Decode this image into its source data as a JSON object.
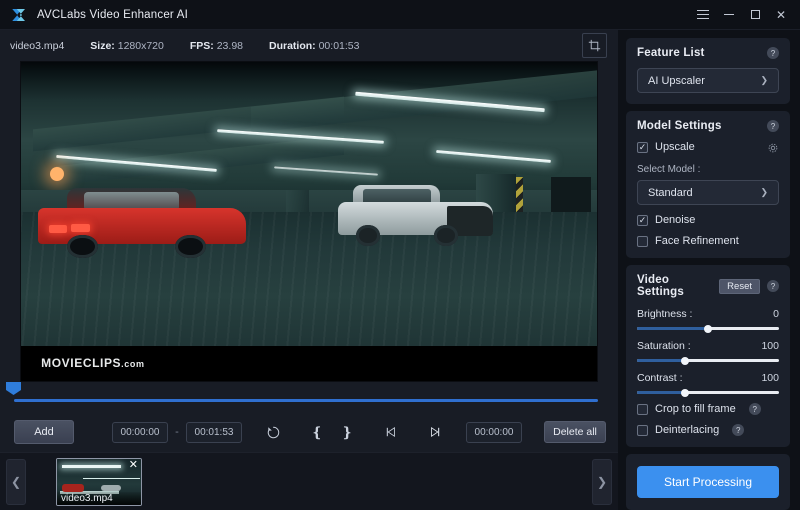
{
  "titlebar": {
    "app_title": "AVCLabs Video Enhancer AI",
    "logo_icon": "play-logo-icon",
    "menu_icon": "hamburger-menu-icon",
    "minimize_icon": "minimize-icon",
    "maximize_icon": "maximize-icon",
    "close_icon": "close-icon"
  },
  "infobar": {
    "filename": "video3.mp4",
    "size_key": "Size:",
    "size_value": "1280x720",
    "fps_key": "FPS:",
    "fps_value": "23.98",
    "duration_key": "Duration:",
    "duration_value": "00:01:53",
    "crop_icon": "crop-icon"
  },
  "preview": {
    "watermark": "MOVIECLIPS",
    "watermark_suffix": ".com"
  },
  "controls": {
    "add_label": "Add",
    "start_time": "00:00:00",
    "separator": "-",
    "end_time": "00:01:53",
    "revert_icon": "revert-icon",
    "mark_in_icon": "mark-in-icon",
    "mark_out_icon": "mark-out-icon",
    "prev_frame_icon": "prev-frame-icon",
    "next_frame_icon": "next-frame-icon",
    "current_time": "00:00:00",
    "delete_all_label": "Delete all"
  },
  "filmstrip": {
    "prev_icon": "chevron-left-icon",
    "next_icon": "chevron-right-icon",
    "remove_icon": "close-icon",
    "items": [
      {
        "label": "video3.mp4"
      }
    ]
  },
  "feature_list": {
    "title": "Feature List",
    "help_icon": "help-icon",
    "selected": "AI Upscaler",
    "chevron_icon": "chevron-down-icon"
  },
  "model_settings": {
    "title": "Model Settings",
    "help_icon": "help-icon",
    "upscale_label": "Upscale",
    "upscale_checked": true,
    "gear_icon": "gear-icon",
    "select_model_label": "Select Model :",
    "model_selected": "Standard",
    "chevron_icon": "chevron-down-icon",
    "denoise_label": "Denoise",
    "denoise_checked": true,
    "face_refinement_label": "Face Refinement",
    "face_refinement_checked": false,
    "check_glyph": "✓"
  },
  "video_settings": {
    "title": "Video Settings",
    "reset_label": "Reset",
    "help_icon": "help-icon",
    "sliders": [
      {
        "label": "Brightness :",
        "value": "0",
        "percent": 50
      },
      {
        "label": "Saturation :",
        "value": "100",
        "percent": 34
      },
      {
        "label": "Contrast :",
        "value": "100",
        "percent": 34
      }
    ],
    "crop_to_fill_label": "Crop to fill frame",
    "crop_to_fill_checked": false,
    "deinterlacing_label": "Deinterlacing",
    "deinterlacing_checked": false
  },
  "process": {
    "start_label": "Start Processing",
    "accent_color": "#3b90ef"
  }
}
